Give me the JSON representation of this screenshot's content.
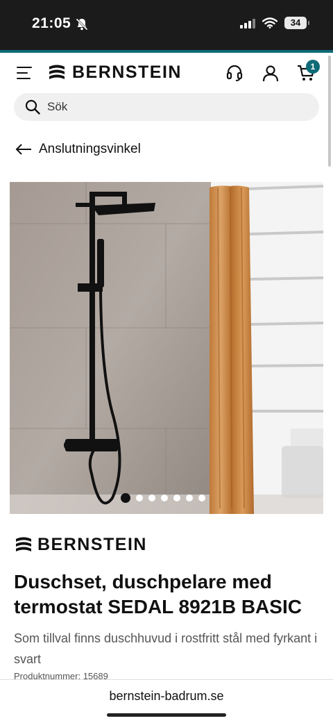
{
  "status_bar": {
    "time": "21:05",
    "battery": "34"
  },
  "header": {
    "brand": "BERNSTEIN",
    "cart_count": "1"
  },
  "search": {
    "placeholder": "Sök"
  },
  "back_link": {
    "label": "Anslutningsvinkel"
  },
  "gallery": {
    "image_count": 7,
    "active_index": 0
  },
  "product": {
    "brand": "BERNSTEIN",
    "title": "Duschset, duschpelare med termostat SEDAL 8921B BASIC",
    "description": "Som tillval finns duschhuvud i rostfritt stål med fyrkant i svart",
    "product_number": "Produktnummer: 15689"
  },
  "browser": {
    "url": "bernstein-badrum.se"
  },
  "colors": {
    "accent": "#0f6b77",
    "status_bar": "#1b1b1b"
  }
}
